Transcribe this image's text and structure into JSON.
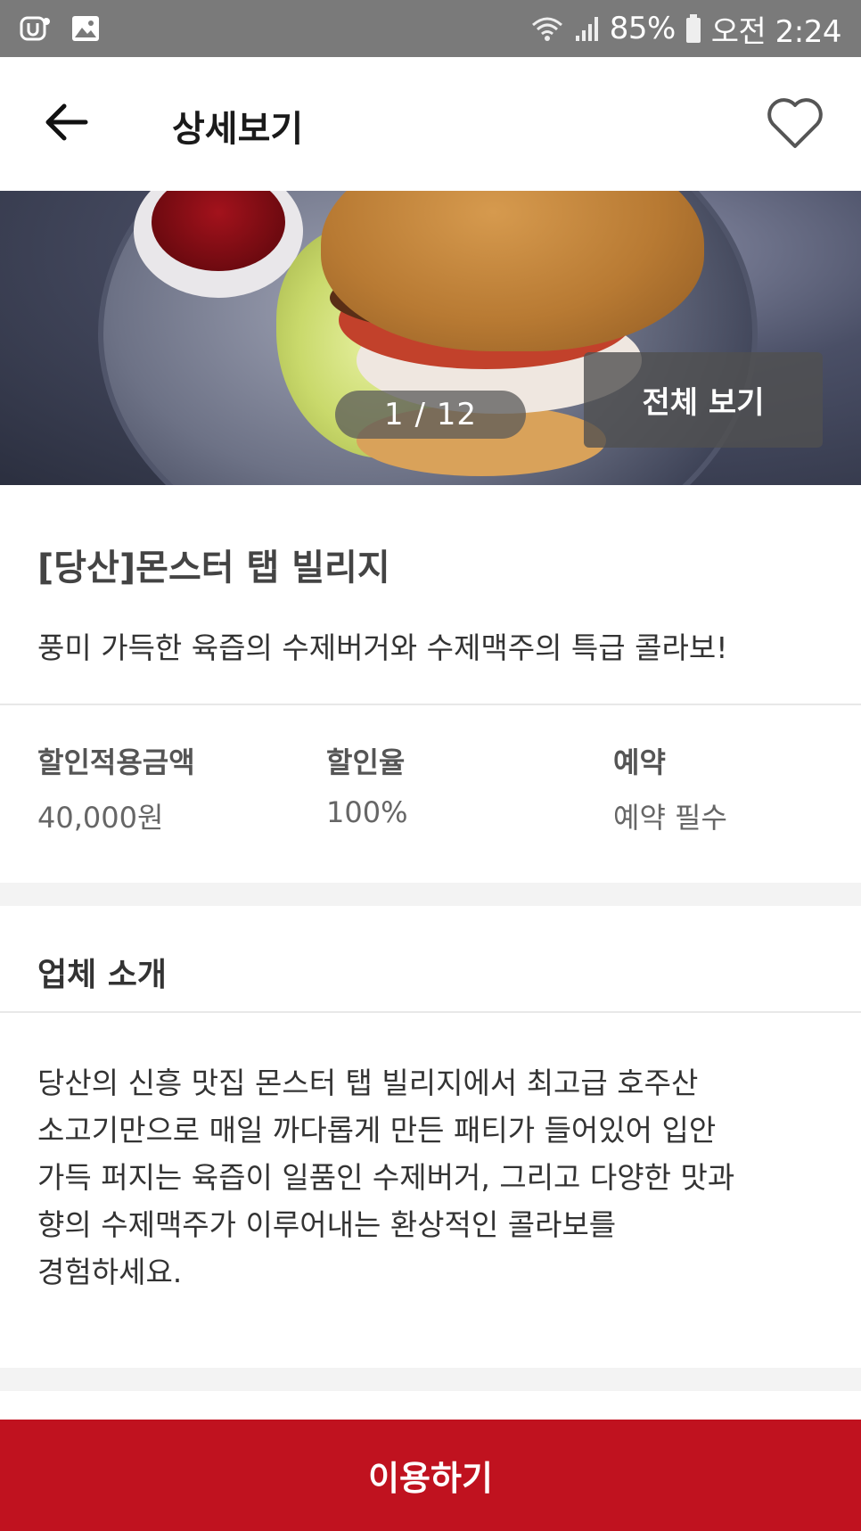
{
  "status_bar": {
    "battery": "85%",
    "time": "오전 2:24",
    "icons": [
      "u-plus-icon",
      "image-icon",
      "wifi-icon",
      "signal-icon",
      "battery-icon"
    ]
  },
  "app_bar": {
    "title": "상세보기",
    "back_icon": "arrow-left-icon",
    "favorite_icon": "heart-outline-icon"
  },
  "gallery": {
    "counter": "1 / 12",
    "view_all_label": "전체 보기"
  },
  "venue": {
    "title": "[당산]몬스터 탭 빌리지",
    "subtitle": "풍미 가득한 육즙의 수제버거와 수제맥주의 특급 콜라보!"
  },
  "info": [
    {
      "label": "할인적용금액",
      "value": "40,000원"
    },
    {
      "label": "할인율",
      "value": "100%"
    },
    {
      "label": "예약",
      "value": "예약 필수"
    }
  ],
  "intro": {
    "title": "업체 소개",
    "body": "당산의 신흥 맛집 몬스터 탭 빌리지에서 최고급 호주산\n소고기만으로 매일 까다롭게 만든 패티가 들어있어 입안\n가득 퍼지는 육즙이 일품인 수제버거, 그리고 다양한 맛과\n향의 수제맥주가 이루어내는 환상적인 콜라보를\n경험하세요."
  },
  "cta": {
    "label": "이용하기",
    "color": "#c0121f"
  }
}
